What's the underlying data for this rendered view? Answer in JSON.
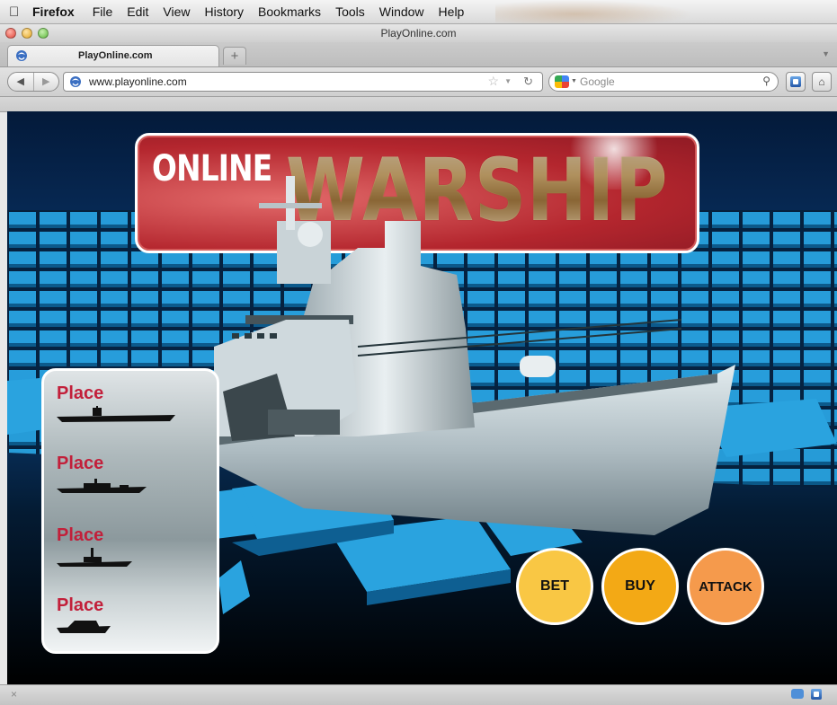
{
  "menubar": {
    "app": "Firefox",
    "items": [
      "File",
      "Edit",
      "View",
      "History",
      "Bookmarks",
      "Tools",
      "Window",
      "Help"
    ]
  },
  "window": {
    "title": "PlayOnline.com"
  },
  "tab": {
    "title": "PlayOnline.com",
    "new_tab": "+"
  },
  "nav": {
    "url": "www.playonline.com",
    "search_engine": "Google",
    "icons": [
      "back-arrow-icon",
      "forward-arrow-icon",
      "bookmark-star-icon",
      "reload-icon",
      "search-icon",
      "sync-icon",
      "home-icon"
    ]
  },
  "game": {
    "logo": {
      "online": "ONLINE",
      "warship": "WARSHIP"
    },
    "place_label": "Place",
    "place_items": [
      {
        "label": "Place",
        "ship": "aircraft-carrier"
      },
      {
        "label": "Place",
        "ship": "destroyer"
      },
      {
        "label": "Place",
        "ship": "frigate"
      },
      {
        "label": "Place",
        "ship": "cruise-ship"
      }
    ],
    "buttons": {
      "bet": "BET",
      "buy": "BUY",
      "attack": "ATTACK"
    },
    "colors": {
      "bet": "#f9c744",
      "buy": "#f3a915",
      "attack": "#f59a4c",
      "place_text": "#c21f3a",
      "logo_red": "#b4262e",
      "tile_blue": "#1f9bd8"
    }
  },
  "statusbar": {
    "close_glyph": "×"
  }
}
